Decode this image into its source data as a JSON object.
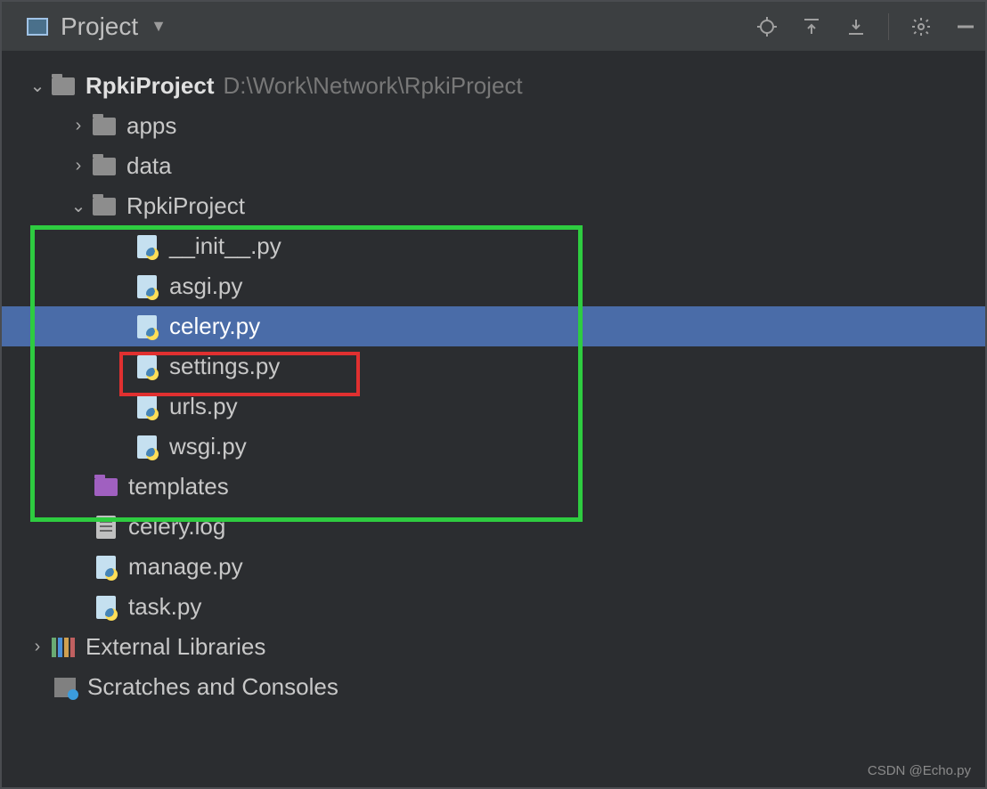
{
  "titlebar": {
    "label": "Project"
  },
  "tree": {
    "root": {
      "name": "RpkiProject",
      "path": "D:\\Work\\Network\\RpkiProject"
    },
    "children1": [
      {
        "name": "apps"
      },
      {
        "name": "data"
      }
    ],
    "sub": {
      "name": "RpkiProject",
      "files": [
        {
          "name": "__init__.py"
        },
        {
          "name": "asgi.py"
        },
        {
          "name": "celery.py",
          "selected": true
        },
        {
          "name": "settings.py"
        },
        {
          "name": "urls.py"
        },
        {
          "name": "wsgi.py"
        }
      ]
    },
    "tail": [
      {
        "name": "templates",
        "type": "folder-purple"
      },
      {
        "name": "celery.log",
        "type": "txt"
      },
      {
        "name": "manage.py",
        "type": "py"
      },
      {
        "name": "task.py",
        "type": "py"
      }
    ],
    "ext": "External Libraries",
    "scratch": "Scratches and Consoles"
  },
  "watermark": "CSDN @Echo.py"
}
